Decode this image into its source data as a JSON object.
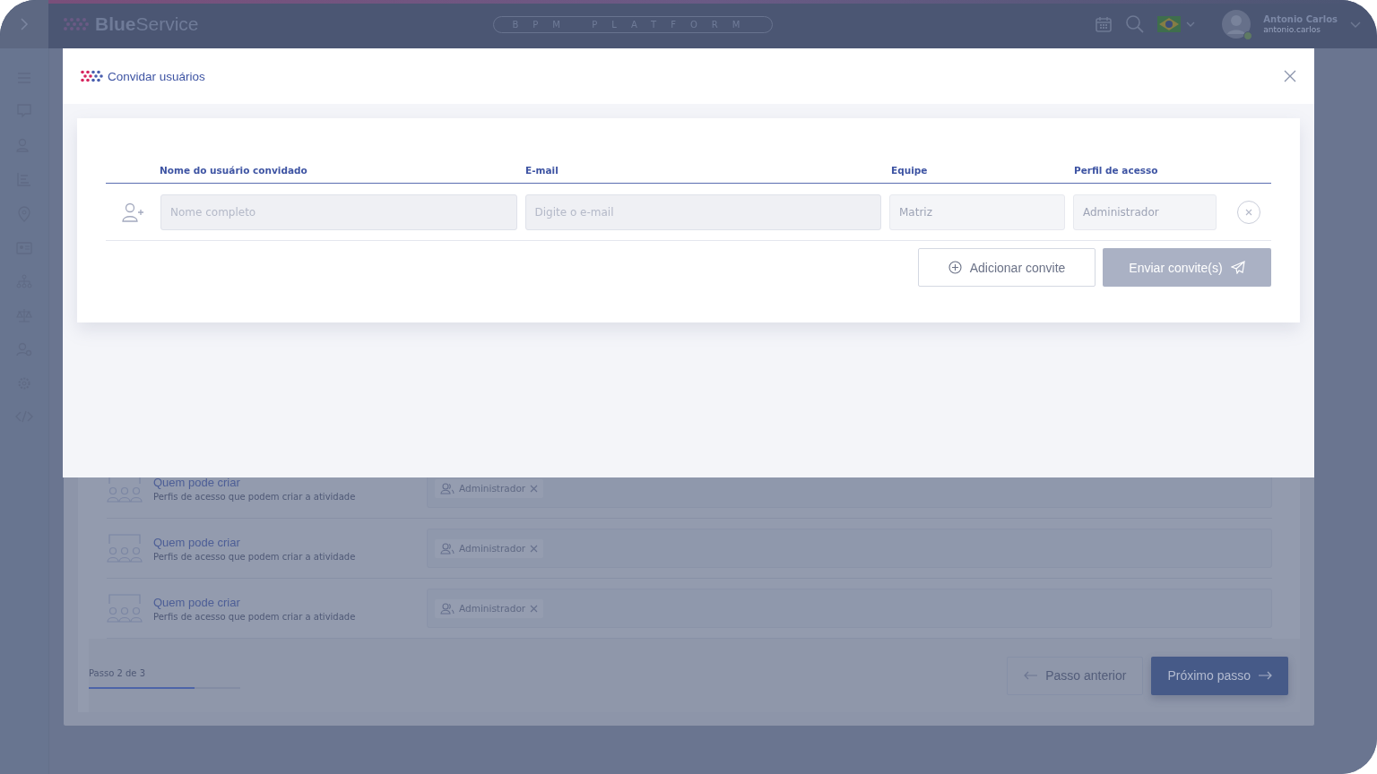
{
  "topbar": {
    "logo": "**Blue**Service",
    "platform_label": "BPM PLATFORM",
    "user": {
      "name": "Antonio Carlos",
      "login": "antonio.carlos",
      "online": true
    }
  },
  "background_form": {
    "rows": [
      {
        "title": "Quem pode criar",
        "subtitle": "Perfis de acesso que podem criar a atividade",
        "tags": [
          "Administrador"
        ]
      },
      {
        "title": "Quem pode criar",
        "subtitle": "Perfis de acesso que podem criar a atividade",
        "tags": [
          "Administrador"
        ]
      },
      {
        "title": "Quem pode criar",
        "subtitle": "Perfis de acesso que podem criar a atividade",
        "tags": [
          "Administrador"
        ]
      }
    ],
    "step": {
      "label": "Passo 2 de 3",
      "level": 0.7
    },
    "buttons": {
      "previous": "Passo anterior",
      "next": "Próximo passo"
    }
  },
  "modal": {
    "title": "Convidar usuários",
    "columns": [
      "Nome do usuário convidado",
      "E-mail",
      "Equipe",
      "Perfil de acesso"
    ],
    "invite_rows": [
      {
        "fields": [
          {
            "placeholder": "Nome completo",
            "disabled": false
          },
          {
            "placeholder": "Digite o e-mail",
            "disabled": false
          },
          {
            "placeholder": "Matriz",
            "disabled": true
          },
          {
            "placeholder": "Administrador",
            "disabled": true
          }
        ]
      }
    ],
    "add_button": "Adicionar convite",
    "send_button": {
      "label": "Enviar convite(s)",
      "disabled": true
    }
  }
}
